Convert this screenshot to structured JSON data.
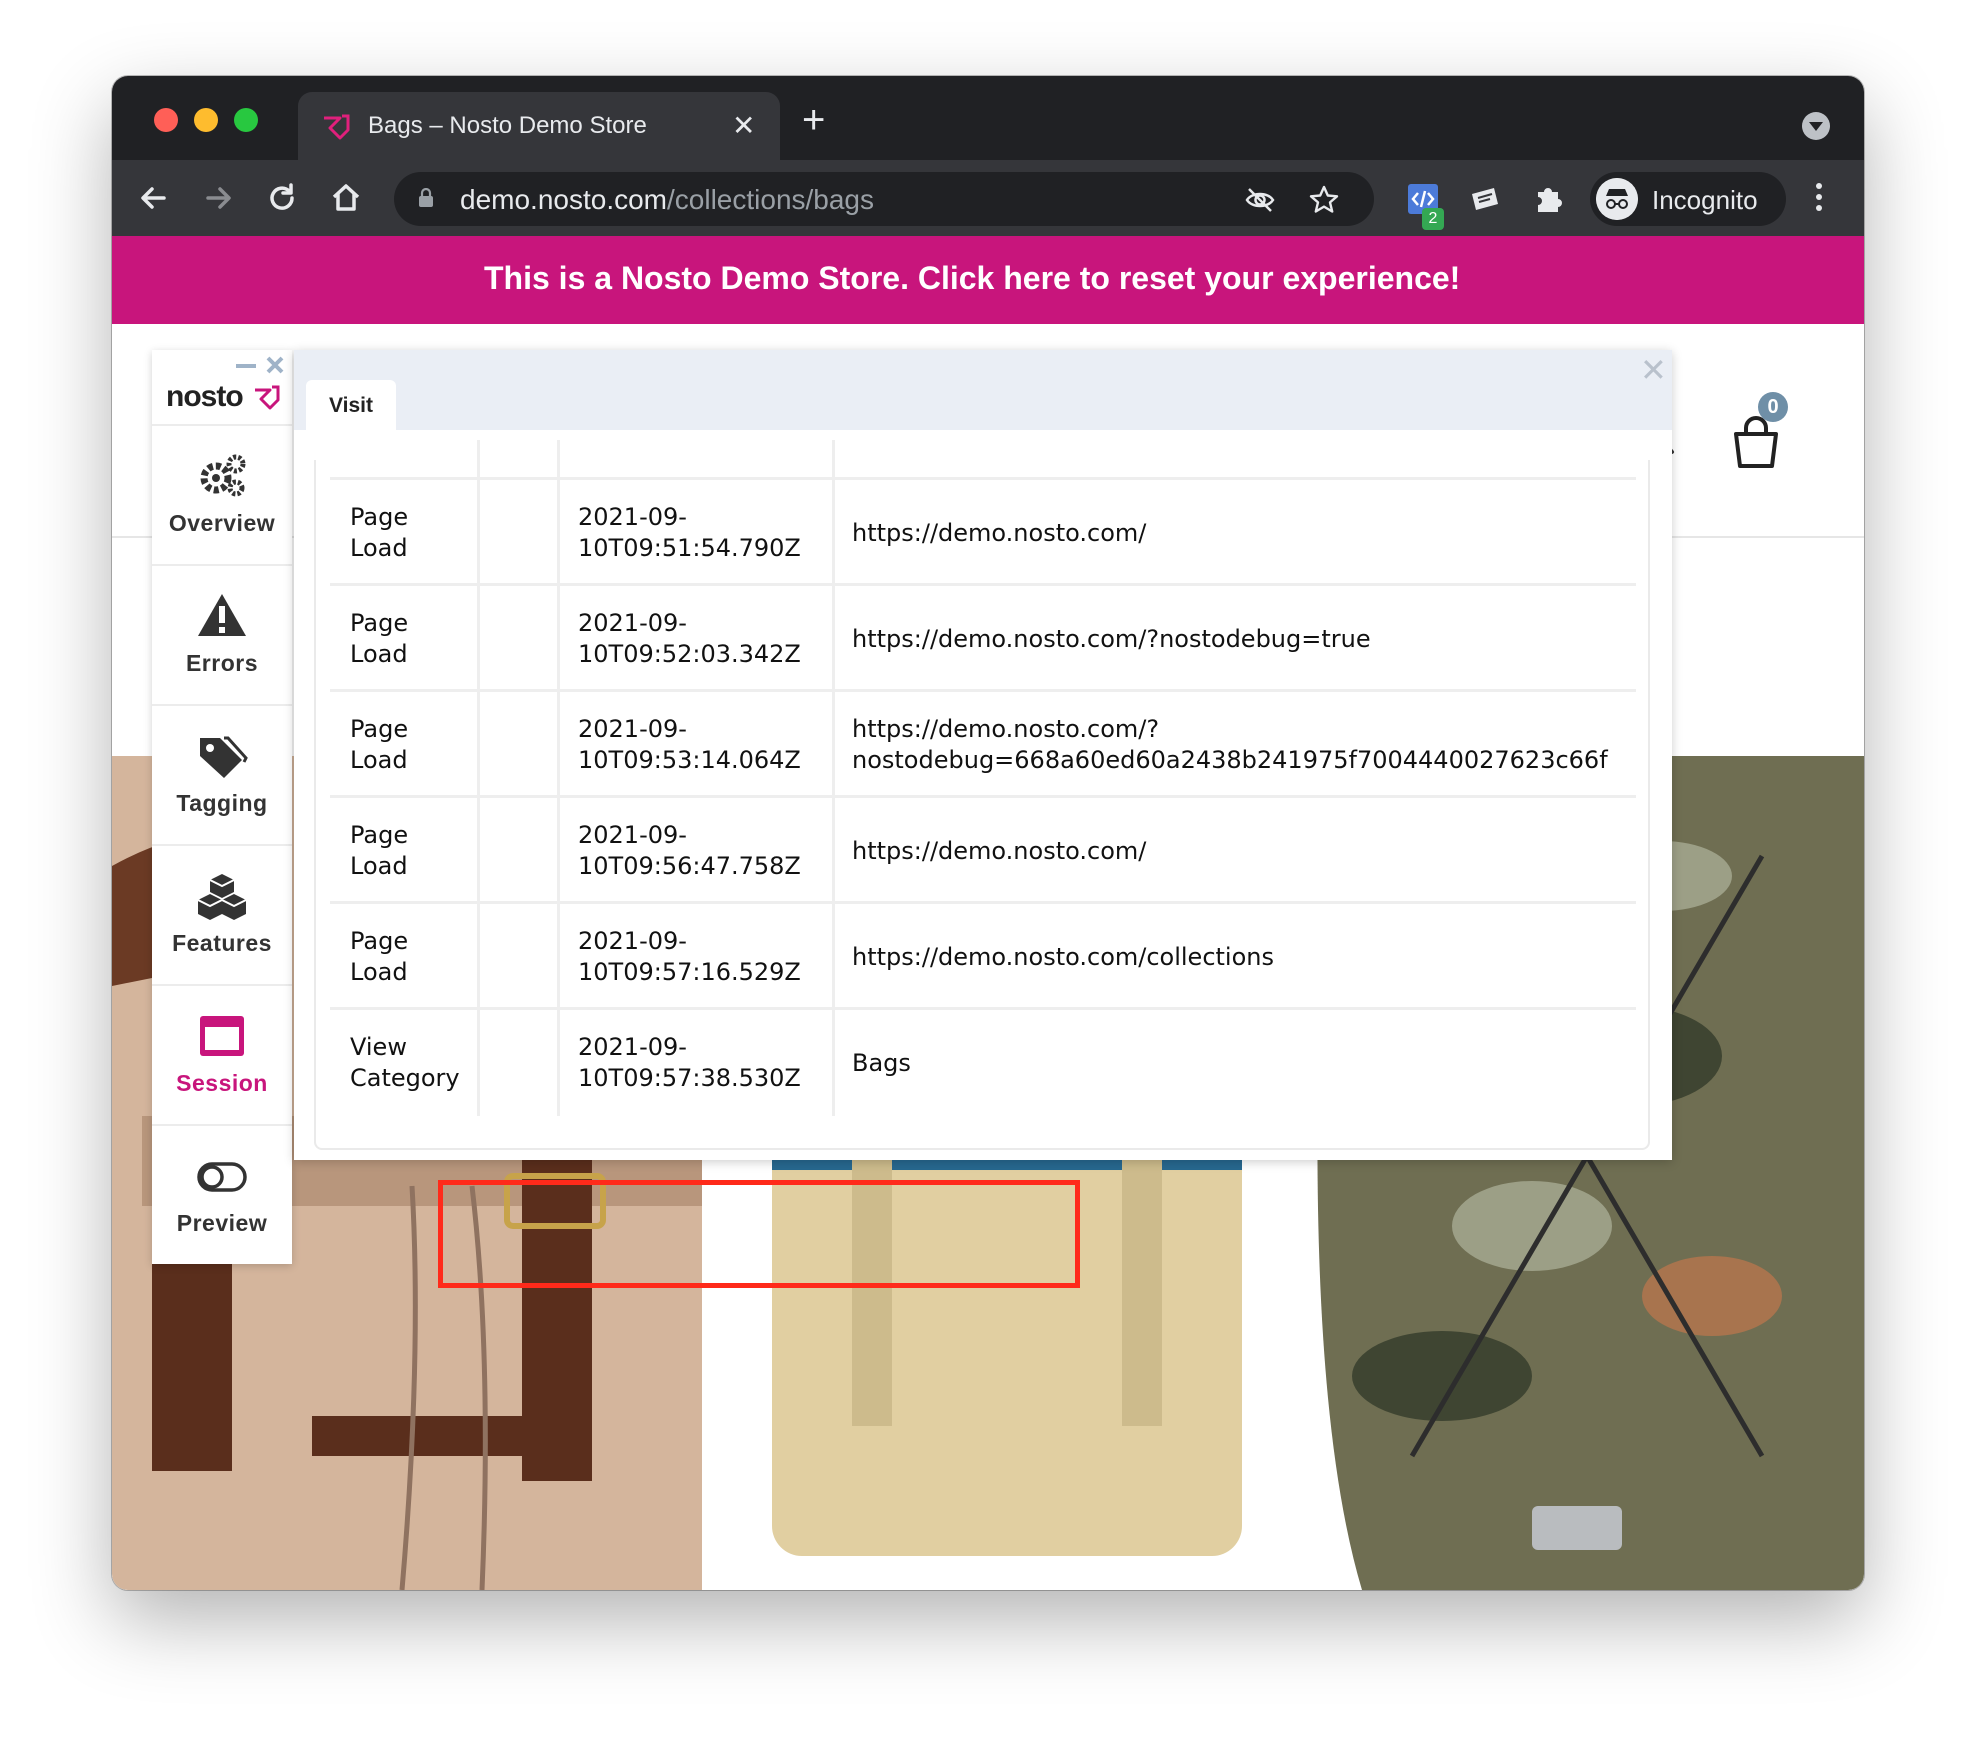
{
  "browser": {
    "tab": {
      "title": "Bags – Nosto Demo Store",
      "close": "✕"
    },
    "new_tab": "+",
    "address": {
      "host": "demo.nosto.com",
      "path": "/collections/bags"
    },
    "extension_badge": "2",
    "profile": {
      "label": "Incognito"
    }
  },
  "store": {
    "promo_banner": "This is a Nosto Demo Store. Click here to reset your experience!",
    "cart_count": "0",
    "brand_color": "#c8157c"
  },
  "nosto_debugger": {
    "logo": "nosto",
    "sidebar": [
      {
        "label": "Overview",
        "icon": "gears-icon"
      },
      {
        "label": "Errors",
        "icon": "warning-icon"
      },
      {
        "label": "Tagging",
        "icon": "tags-icon"
      },
      {
        "label": "Features",
        "icon": "cubes-icon"
      },
      {
        "label": "Session",
        "icon": "window-icon",
        "active": true
      },
      {
        "label": "Preview",
        "icon": "toggle-icon"
      }
    ],
    "panel_tab": "Visit",
    "panel_close": "✕",
    "events": [
      {
        "type_1": "Page",
        "type_2": "Load",
        "time_1": "2021-09-",
        "time_2": "10T09:51:54.790Z",
        "value_1": "https://demo.nosto.com/",
        "value_2": ""
      },
      {
        "type_1": "Page",
        "type_2": "Load",
        "time_1": "2021-09-",
        "time_2": "10T09:52:03.342Z",
        "value_1": "https://demo.nosto.com/?nostodebug=true",
        "value_2": ""
      },
      {
        "type_1": "Page",
        "type_2": "Load",
        "time_1": "2021-09-",
        "time_2": "10T09:53:14.064Z",
        "value_1": "https://demo.nosto.com/?",
        "value_2": "nostodebug=668a60ed60a2438b241975f7004440027623c66f"
      },
      {
        "type_1": "Page",
        "type_2": "Load",
        "time_1": "2021-09-",
        "time_2": "10T09:56:47.758Z",
        "value_1": "https://demo.nosto.com/",
        "value_2": ""
      },
      {
        "type_1": "Page",
        "type_2": "Load",
        "time_1": "2021-09-",
        "time_2": "10T09:57:16.529Z",
        "value_1": "https://demo.nosto.com/collections",
        "value_2": ""
      },
      {
        "type_1": "View",
        "type_2": "Category",
        "time_1": "2021-09-",
        "time_2": "10T09:57:38.530Z",
        "value_1": "Bags",
        "value_2": "",
        "highlighted": true
      }
    ],
    "highlight_color": "#ff2a1a"
  }
}
